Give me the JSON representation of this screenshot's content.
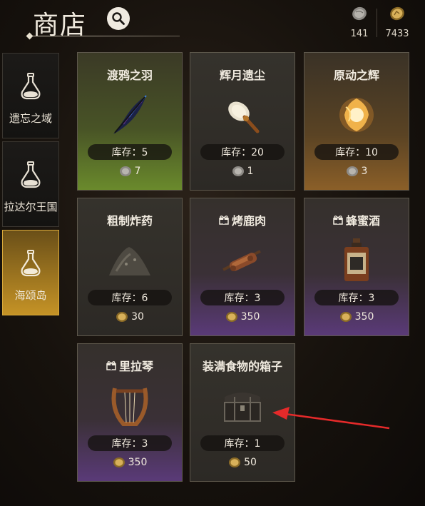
{
  "header": {
    "title": "商店",
    "currencies": [
      {
        "icon": "gray-stone-coin-icon",
        "amount": "141"
      },
      {
        "icon": "gold-coin-icon",
        "amount": "7433"
      }
    ]
  },
  "sidebar": {
    "tabs": [
      {
        "label": "遗忘之域",
        "active": false
      },
      {
        "label": "拉达尔王国",
        "active": false
      },
      {
        "label": "海颂岛",
        "active": true
      }
    ]
  },
  "shop": {
    "stock_label": "库存：",
    "items": [
      {
        "name": "渡鸦之羽",
        "stock": "库存：5",
        "price": "7",
        "currency": "stone",
        "gift": false,
        "rarity": "green",
        "icon": "raven-feather-icon"
      },
      {
        "name": "辉月遗尘",
        "stock": "库存：20",
        "price": "1",
        "currency": "stone",
        "gift": false,
        "rarity": "gray",
        "icon": "moon-dust-icon"
      },
      {
        "name": "原动之辉",
        "stock": "库存：10",
        "price": "3",
        "currency": "stone",
        "gift": false,
        "rarity": "orange",
        "icon": "prime-radiance-icon"
      },
      {
        "name": "粗制炸药",
        "stock": "库存：6",
        "price": "30",
        "currency": "gold",
        "gift": false,
        "rarity": "gray",
        "icon": "crude-explosive-icon"
      },
      {
        "name": "烤鹿肉",
        "stock": "库存：3",
        "price": "350",
        "currency": "gold",
        "gift": true,
        "rarity": "purple",
        "icon": "roast-venison-icon"
      },
      {
        "name": "蜂蜜酒",
        "stock": "库存：3",
        "price": "350",
        "currency": "gold",
        "gift": true,
        "rarity": "purple",
        "icon": "mead-bottle-icon"
      },
      {
        "name": "里拉琴",
        "stock": "库存：3",
        "price": "350",
        "currency": "gold",
        "gift": true,
        "rarity": "purple",
        "icon": "lyre-icon"
      },
      {
        "name": "装满食物的箱子",
        "stock": "库存：1",
        "price": "50",
        "currency": "gold",
        "gift": false,
        "rarity": "gray",
        "icon": "food-chest-icon"
      }
    ]
  },
  "annotation": {
    "icon": "red-arrow-icon",
    "color": "#e52a2a"
  }
}
